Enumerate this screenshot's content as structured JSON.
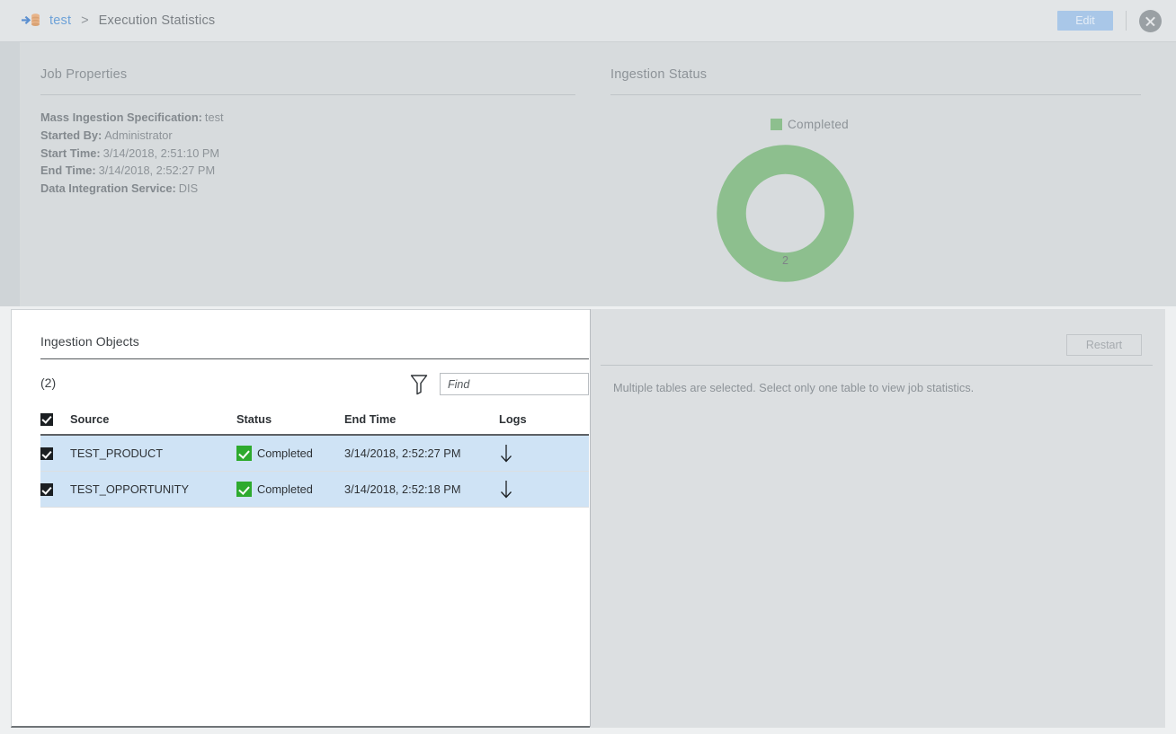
{
  "header": {
    "app_icon": "mass-ingestion-icon",
    "breadcrumb_link": "test",
    "breadcrumb_separator": ">",
    "breadcrumb_current": "Execution Statistics",
    "edit_label": "Edit",
    "close_icon": "close-icon"
  },
  "job_properties": {
    "title": "Job Properties",
    "fields": [
      {
        "label": "Mass Ingestion Specification:",
        "value": "test"
      },
      {
        "label": "Started By:",
        "value": "Administrator"
      },
      {
        "label": "Start Time:",
        "value": "3/14/2018, 2:51:10 PM"
      },
      {
        "label": "End Time:",
        "value": "3/14/2018, 2:52:27 PM"
      },
      {
        "label": "Data Integration Service:",
        "value": "DIS"
      }
    ]
  },
  "ingestion_status": {
    "title": "Ingestion Status",
    "legend_label": "Completed",
    "legend_color": "#8dbf8e",
    "center_value": "2"
  },
  "chart_data": {
    "type": "pie",
    "title": "Ingestion Status",
    "labels": [
      "Completed"
    ],
    "values": [
      2
    ],
    "colors": [
      "#8dbf8e"
    ],
    "total": 2,
    "donut": true,
    "legend_position": "top",
    "data_label": "2"
  },
  "ingestion_objects": {
    "title": "Ingestion Objects",
    "count_label": "(2)",
    "filter_icon": "filter-funnel-icon",
    "find_placeholder": "Find",
    "find_value": "",
    "columns": [
      "Source",
      "Status",
      "End Time",
      "Logs"
    ],
    "rows": [
      {
        "selected": true,
        "source": "TEST_PRODUCT",
        "status": "Completed",
        "end_time": "3/14/2018, 2:52:27 PM",
        "logs_icon": "download-icon"
      },
      {
        "selected": true,
        "source": "TEST_OPPORTUNITY",
        "status": "Completed",
        "end_time": "3/14/2018, 2:52:18 PM",
        "logs_icon": "download-icon"
      }
    ]
  },
  "details_panel": {
    "restart_label": "Restart",
    "message": "Multiple tables are selected. Select only one table to view job statistics."
  }
}
